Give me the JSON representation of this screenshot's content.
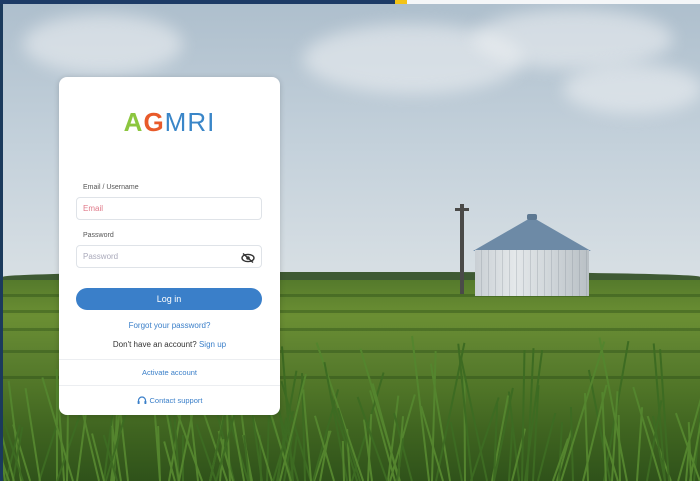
{
  "brand": {
    "logo_part_a": "A",
    "logo_part_g": "G",
    "logo_part_mri": "MRI",
    "colors": {
      "green": "#8cc63f",
      "orange": "#e85a2a",
      "blue": "#3a86c8"
    }
  },
  "login": {
    "email_label": "Email / Username",
    "email_placeholder": "Email",
    "password_label": "Password",
    "password_placeholder": "Password",
    "login_button": "Log in",
    "forgot_password": "Forgot your password?",
    "no_account_text": "Don't have an account?",
    "sign_up": "Sign up",
    "activate_account": "Activate account",
    "contact_support": "Contact support"
  },
  "icons": {
    "password_toggle": "eye-slash-icon",
    "support": "headset-icon"
  },
  "theme": {
    "accent": "#3a7fc9",
    "topbar_navy": "#1d3b66",
    "topbar_gold": "#f2c318"
  }
}
